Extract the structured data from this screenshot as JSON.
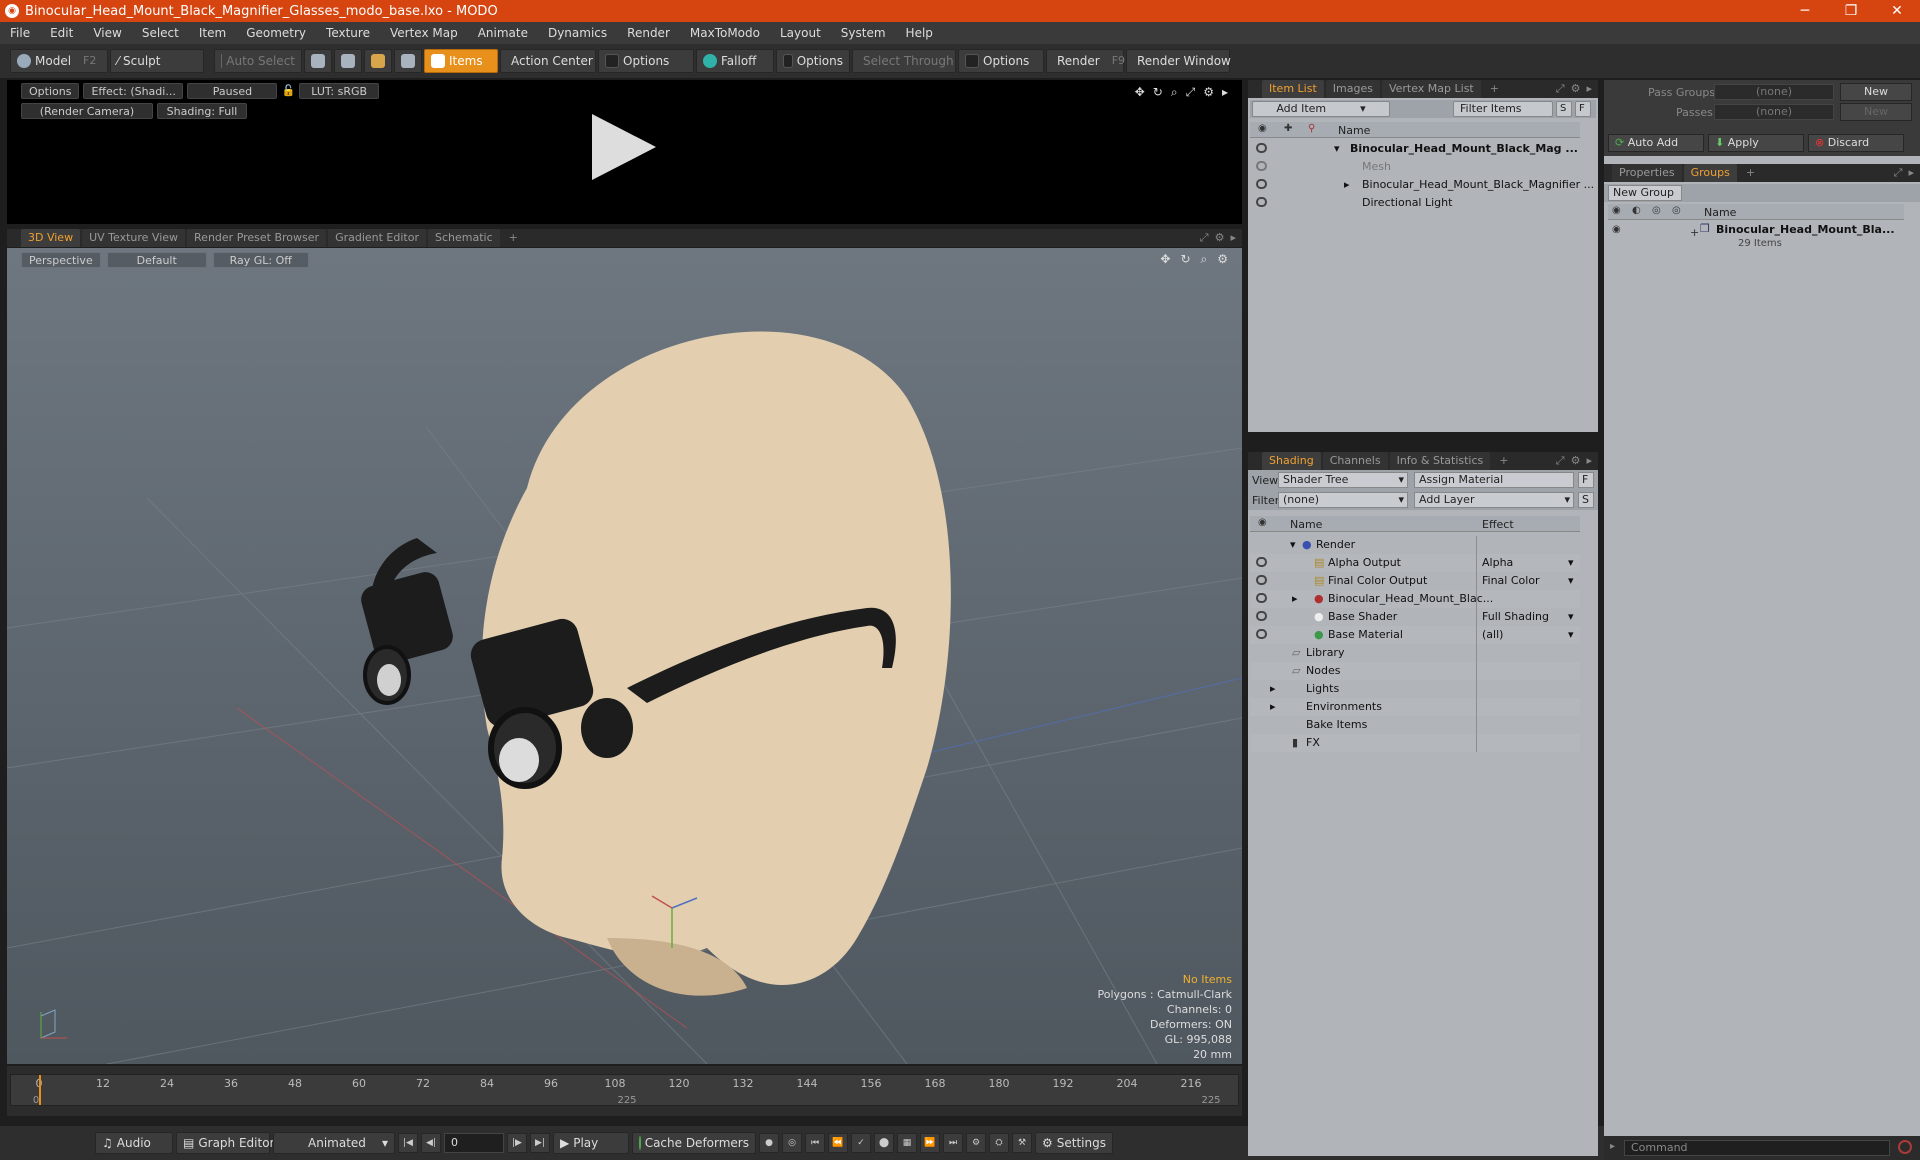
{
  "window": {
    "title": "Binocular_Head_Mount_Black_Magnifier_Glasses_modo_base.lxo - MODO",
    "minimize": "─",
    "maximize": "❐",
    "close": "✕"
  },
  "menu": [
    "File",
    "Edit",
    "View",
    "Select",
    "Item",
    "Geometry",
    "Texture",
    "Vertex Map",
    "Animate",
    "Dynamics",
    "Render",
    "MaxToModo",
    "Layout",
    "System",
    "Help"
  ],
  "toolbar": {
    "model": "Model",
    "model_key": "F2",
    "sculpt": "Sculpt",
    "auto_select": "Auto Select",
    "items": "Items",
    "action_center": "Action Center",
    "options1": "Options",
    "falloff": "Falloff",
    "options2": "Options",
    "select_through": "Select Through",
    "options3": "Options",
    "render": "Render",
    "render_key": "F9",
    "render_window": "Render Window"
  },
  "preview": {
    "options": "Options",
    "effect": "Effect: (Shadi...",
    "paused": "Paused",
    "lut": "LUT: sRGB",
    "camera": "(Render Camera)",
    "shading": "Shading: Full"
  },
  "viewport_tabs": [
    "3D View",
    "UV Texture View",
    "Render Preset Browser",
    "Gradient Editor",
    "Schematic",
    "+"
  ],
  "viewport": {
    "perspective": "Perspective",
    "default": "Default",
    "raygl": "Ray GL: Off",
    "info": {
      "no_items": "No Items",
      "polygons": "Polygons : Catmull-Clark",
      "channels": "Channels: 0",
      "deformers": "Deformers: ON",
      "gl": "GL: 995,088",
      "scale": "20 mm"
    }
  },
  "timeline": {
    "ticks": [
      "0",
      "12",
      "24",
      "36",
      "48",
      "60",
      "72",
      "84",
      "96",
      "108",
      "120",
      "132",
      "144",
      "156",
      "168",
      "180",
      "192",
      "204",
      "216"
    ],
    "sub_start": "0",
    "sub_mid": "225",
    "sub_end": "225"
  },
  "bottombar": {
    "audio": "Audio",
    "graph_editor": "Graph Editor",
    "animated": "Animated",
    "frame": "0",
    "play": "Play",
    "cache_deformers": "Cache Deformers",
    "settings": "Settings"
  },
  "itemlist": {
    "tabs": [
      "Item List",
      "Images",
      "Vertex Map List",
      "+"
    ],
    "add_item": "Add Item",
    "filter_items": "Filter Items",
    "s": "S",
    "f": "F",
    "col_name": "Name",
    "rows": [
      "Binocular_Head_Mount_Black_Mag ...",
      "Mesh",
      "Binocular_Head_Mount_Black_Magnifier ...",
      "Directional Light"
    ]
  },
  "shading": {
    "tabs": [
      "Shading",
      "Channels",
      "Info & Statistics",
      "+"
    ],
    "view_label": "View",
    "view_value": "Shader Tree",
    "assign_material": "Assign Material",
    "f": "F",
    "filter_label": "Filter",
    "filter_value": "(none)",
    "add_layer": "Add Layer",
    "s": "S",
    "col_name": "Name",
    "col_effect": "Effect",
    "rows": [
      {
        "name": "Render",
        "effect": ""
      },
      {
        "name": "Alpha Output",
        "effect": "Alpha"
      },
      {
        "name": "Final Color Output",
        "effect": "Final Color"
      },
      {
        "name": "Binocular_Head_Mount_Blac...",
        "effect": ""
      },
      {
        "name": "Base Shader",
        "effect": "Full Shading"
      },
      {
        "name": "Base Material",
        "effect": "(all)"
      },
      {
        "name": "Library",
        "effect": ""
      },
      {
        "name": "Nodes",
        "effect": ""
      },
      {
        "name": "Lights",
        "effect": ""
      },
      {
        "name": "Environments",
        "effect": ""
      },
      {
        "name": "Bake Items",
        "effect": ""
      },
      {
        "name": "FX",
        "effect": ""
      }
    ]
  },
  "groups": {
    "pass_groups": "Pass Groups",
    "passes": "Passes",
    "none1": "(none)",
    "none2": "(none)",
    "new1": "New",
    "new2": "New",
    "auto_add": "Auto Add",
    "apply": "Apply",
    "discard": "Discard",
    "tabs": [
      "Properties",
      "Groups",
      "+"
    ],
    "new_group": "New Group",
    "col_name": "Name",
    "group_name": "Binocular_Head_Mount_Bla...",
    "group_count": "29 Items"
  },
  "command": {
    "placeholder": "Command"
  }
}
